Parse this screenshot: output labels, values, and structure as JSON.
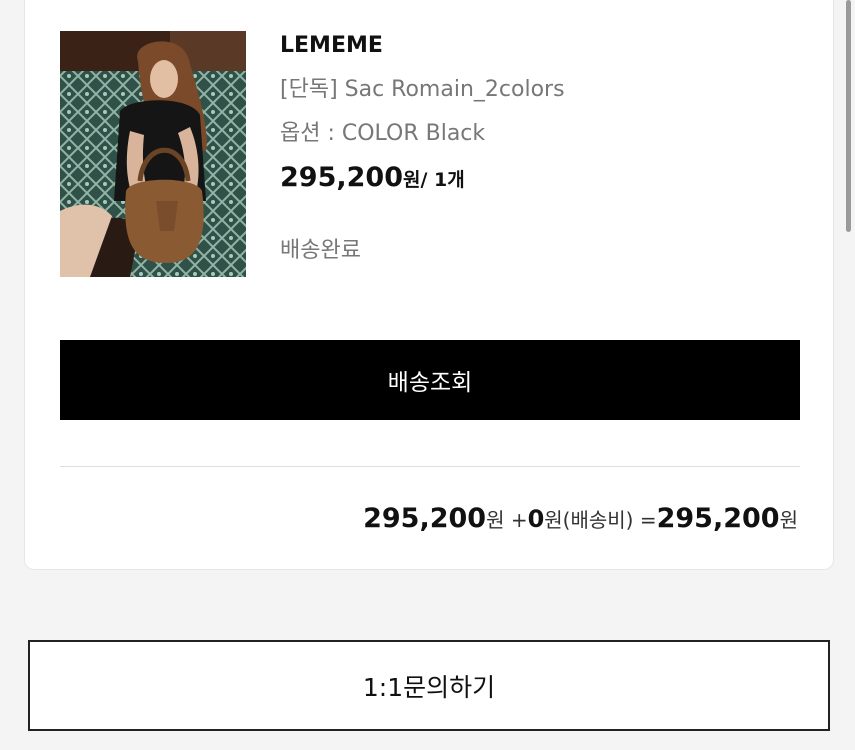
{
  "order_item": {
    "brand": "LEMEME",
    "product_name": "[단독] Sac Romain_2colors",
    "option": "옵션 : COLOR Black",
    "price": "295,200",
    "price_unit": "원/ 1개",
    "status": "배송완료",
    "image_icon": "product-photo-brown-suede-bag"
  },
  "track_button_label": "배송조회",
  "totals": {
    "subtotal": "295,200",
    "subtotal_unit": "원 +",
    "shipping": "0",
    "shipping_unit": "원(배송비) =",
    "total": "295,200",
    "total_unit": "원"
  },
  "inquiry_button_label": "1:1문의하기",
  "colors": {
    "button_dark": "#000000",
    "muted_text": "#777777",
    "background": "#f4f4f4"
  }
}
